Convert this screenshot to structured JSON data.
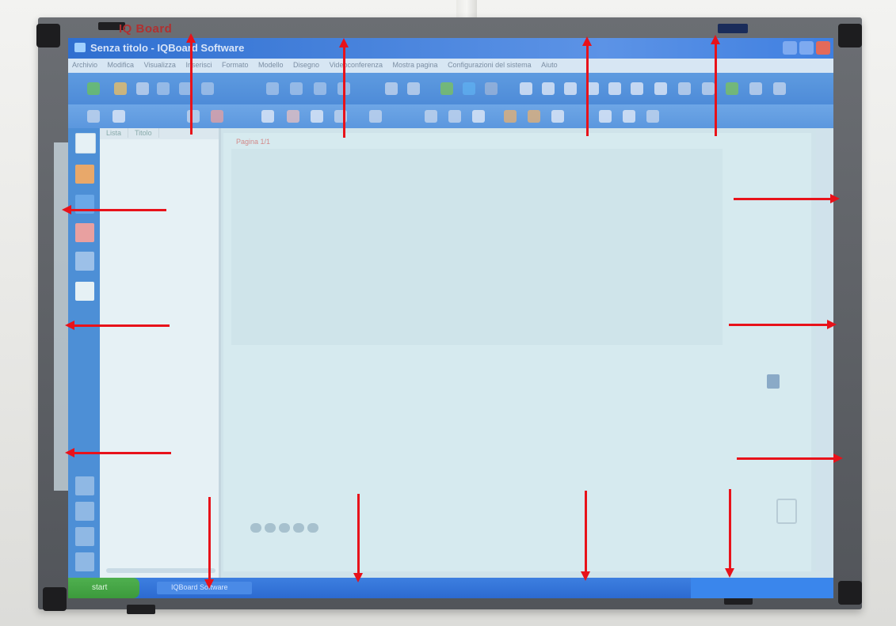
{
  "board": {
    "brand": "IQ Board"
  },
  "window": {
    "title": "Senza titolo - IQBoard Software"
  },
  "menu": {
    "items": [
      "Archivio",
      "Modifica",
      "Visualizza",
      "Inserisci",
      "Formato",
      "Modello",
      "Disegno",
      "Videoconferenza",
      "Mostra pagina",
      "Configurazioni del sistema",
      "Aiuto"
    ]
  },
  "panel": {
    "tab_list": "Lista",
    "tab_title": "Titolo"
  },
  "canvas": {
    "page_label": "Pagina 1/1"
  },
  "taskbar": {
    "start_label": "start",
    "task_label": "IQBoard Software"
  },
  "colors": {
    "arrow": "#e8121a",
    "titlebar": "#2f6fd0",
    "screen": "#cfe3ea",
    "frame": "#5e6166"
  }
}
